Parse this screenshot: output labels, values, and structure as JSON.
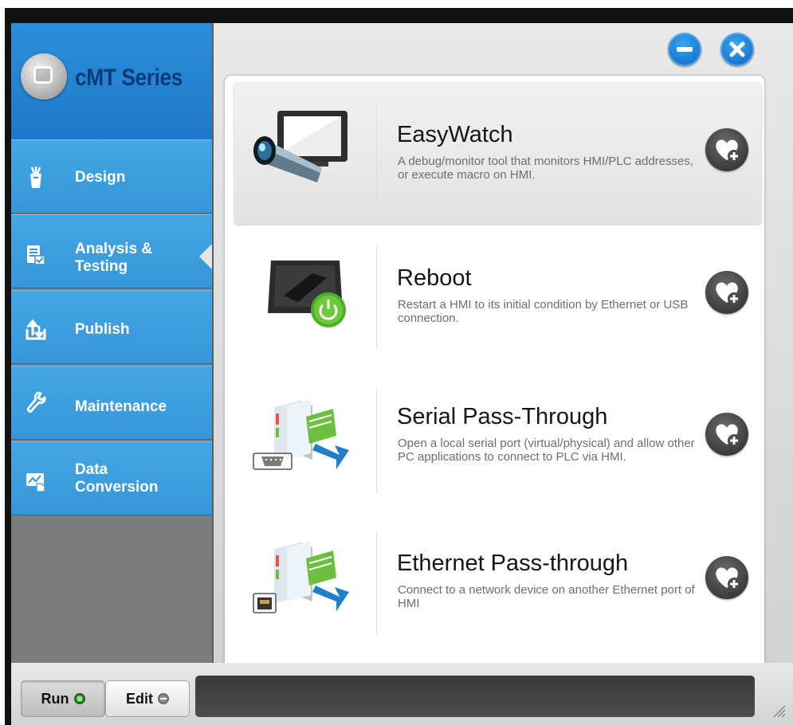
{
  "app": {
    "brand_name": "cMT Series"
  },
  "window_controls": {
    "minimize_icon": "minus-icon",
    "close_icon": "close-icon",
    "accent": "#1f86dc"
  },
  "sidebar": {
    "items": [
      {
        "label": "Design",
        "icon": "design-icon"
      },
      {
        "label": "Analysis & Testing",
        "label_line1": "Analysis &",
        "label_line2": "Testing",
        "icon": "checklist-icon",
        "selected": true
      },
      {
        "label": "Publish",
        "icon": "publish-icon"
      },
      {
        "label": "Maintenance",
        "icon": "wrench-icon"
      },
      {
        "label": "Data Conversion",
        "label_line1": "Data",
        "label_line2": "Conversion",
        "icon": "data-conversion-icon"
      }
    ]
  },
  "tools": [
    {
      "title": "EasyWatch",
      "description": "A debug/monitor tool that monitors HMI/PLC addresses, or execute macro on HMI.",
      "icon": "telescope-monitor-icon",
      "selected": true
    },
    {
      "title": "Reboot",
      "description": "Restart a HMI to its initial condition by Ethernet or USB connection.",
      "icon": "hmi-power-icon"
    },
    {
      "title": "Serial Pass-Through",
      "description": "Open a local serial port (virtual/physical) and allow other PC applications to connect to PLC via HMI.",
      "icon": "serial-port-icon"
    },
    {
      "title": "Ethernet Pass-through",
      "description": "Connect to a network device on another Ethernet port of HMI",
      "icon": "ethernet-port-icon"
    }
  ],
  "bottom_bar": {
    "run_label": "Run",
    "edit_label": "Edit",
    "mode": "Run",
    "status_text": ""
  }
}
